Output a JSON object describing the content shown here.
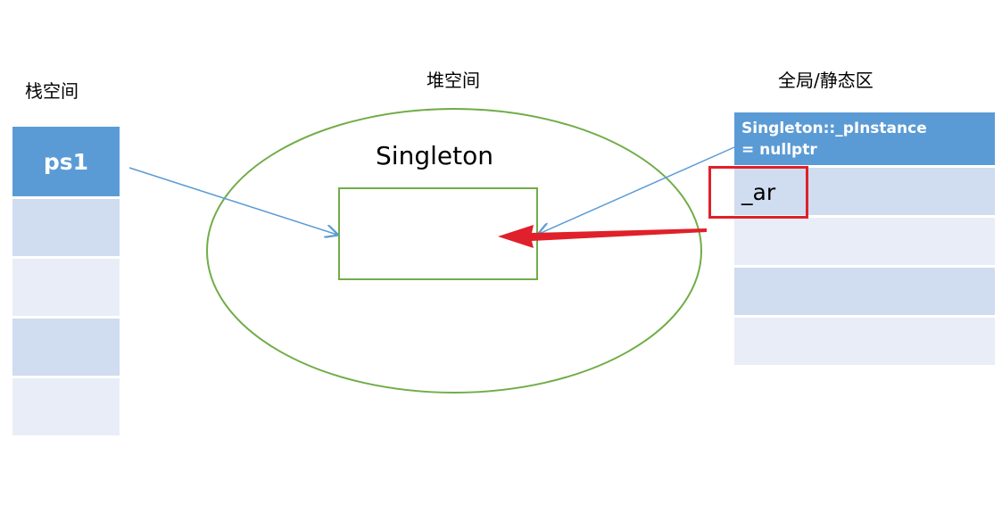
{
  "regions": {
    "stack": {
      "title": "栈空间",
      "cells": [
        "ps1",
        "",
        "",
        "",
        ""
      ]
    },
    "heap": {
      "title": "堆空间",
      "object_label": "Singleton"
    },
    "static": {
      "title": "全局/静态区",
      "header_line1": "Singleton::_pInstance",
      "header_line2": "= nullptr",
      "highlighted_cell": "_ar"
    }
  },
  "colors": {
    "header_blue": "#5b9bd5",
    "cell_dark": "#d0dcef",
    "cell_light": "#e8edf7",
    "ellipse_green": "#70ad47",
    "arrow_blue": "#5b9bd5",
    "highlight_red": "#e0202a"
  }
}
